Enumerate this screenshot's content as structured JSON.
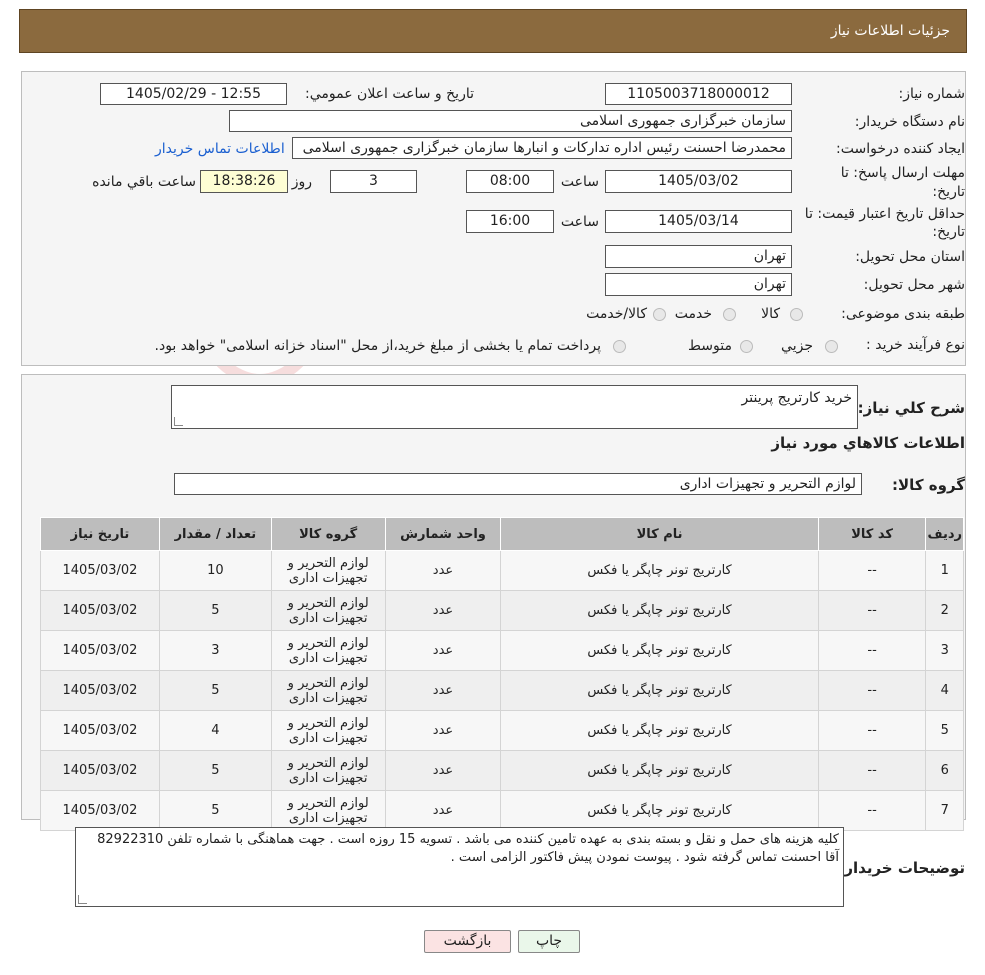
{
  "header": {
    "title": "جزئیات اطلاعات نیاز"
  },
  "form": {
    "need_number_label": "شماره نیاز:",
    "need_number": "1105003718000012",
    "announce_label": "تاريخ و ساعت اعلان عمومي:",
    "announce_value": "1405/02/29 - 12:55",
    "buyer_org_label": "نام دستگاه خريدار:",
    "buyer_org": "سازمان خبرگزاری جمهوری اسلامی",
    "creator_label": "ايجاد کننده درخواست:",
    "creator": "محمدرضا احسنت رئیس اداره تداركات و انبارها سازمان خبرگزاری جمهوری اسلامی",
    "contact_link": "اطلاعات تماس خريدار",
    "deadline_label_1": "مهلت ارسال پاسخ: تا",
    "deadline_label_2": "تاريخ:",
    "deadline_date": "1405/03/02",
    "time_label": "ساعت",
    "deadline_time": "08:00",
    "days_value": "3",
    "days_label": "روز و",
    "remaining_time": "18:38:26",
    "remaining_label": "ساعت باقي مانده",
    "validity_label_1": "حداقل تاريخ اعتبار قيمت: تا",
    "validity_label_2": "تاريخ:",
    "validity_date": "1405/03/14",
    "validity_time": "16:00",
    "province_label": "استان محل تحويل:",
    "province": "تهران",
    "city_label": "شهر محل تحويل:",
    "city": "تهران",
    "category_label": "طبقه بندی موضوعی:",
    "category_options": [
      "كالا",
      "خدمت",
      "كالا/خدمت"
    ],
    "process_label": "نوع فرآيند خريد :",
    "process_options": [
      "جزيي",
      "متوسط"
    ],
    "process_note": "پرداخت تمام يا بخشی از مبلغ خريد،از محل \"اسناد خزانه اسلامی\" خواهد بود."
  },
  "summary": {
    "desc_label": "شرح كلي نياز:",
    "desc_value": "خريد کارتريج پرينتر",
    "goods_title": "اطلاعات كالاهاي مورد نياز",
    "group_label": "گروه كالا:",
    "group_value": "لوازم التحرير و تجهيزات اداری"
  },
  "table": {
    "headers": [
      "رديف",
      "كد كالا",
      "نام كالا",
      "واحد شمارش",
      "گروه كالا",
      "تعداد / مقدار",
      "تاريخ نياز"
    ],
    "rows": [
      [
        "1",
        "--",
        "كارتريج تونر چاپگر يا فكس",
        "عدد",
        "لوازم التحرير و تجهيزات اداری",
        "10",
        "1405/03/02"
      ],
      [
        "2",
        "--",
        "كارتريج تونر چاپگر يا فكس",
        "عدد",
        "لوازم التحرير و تجهيزات اداری",
        "5",
        "1405/03/02"
      ],
      [
        "3",
        "--",
        "كارتريج تونر چاپگر يا فكس",
        "عدد",
        "لوازم التحرير و تجهيزات اداری",
        "3",
        "1405/03/02"
      ],
      [
        "4",
        "--",
        "كارتريج تونر چاپگر يا فكس",
        "عدد",
        "لوازم التحرير و تجهيزات اداری",
        "5",
        "1405/03/02"
      ],
      [
        "5",
        "--",
        "كارتريج تونر چاپگر يا فكس",
        "عدد",
        "لوازم التحرير و تجهيزات اداری",
        "4",
        "1405/03/02"
      ],
      [
        "6",
        "--",
        "كارتريج تونر چاپگر يا فكس",
        "عدد",
        "لوازم التحرير و تجهيزات اداری",
        "5",
        "1405/03/02"
      ],
      [
        "7",
        "--",
        "كارتريج تونر چاپگر يا فكس",
        "عدد",
        "لوازم التحرير و تجهيزات اداری",
        "5",
        "1405/03/02"
      ]
    ]
  },
  "buyer_notes": {
    "label": "توضيحات خريدار:",
    "text": "کلیه هزینه های حمل و نقل و بسته بندی به عهده تامین کننده می باشد . تسویه 15 روزه است . جهت هماهنگی با شماره تلفن 82922310 آقا احسنت تماس گرفته شود . پیوست نمودن پیش فاکتور الزامی است ."
  },
  "buttons": {
    "print": "چاپ",
    "back": "بازگشت"
  },
  "watermark": {
    "text": "AriaTender.neT"
  }
}
